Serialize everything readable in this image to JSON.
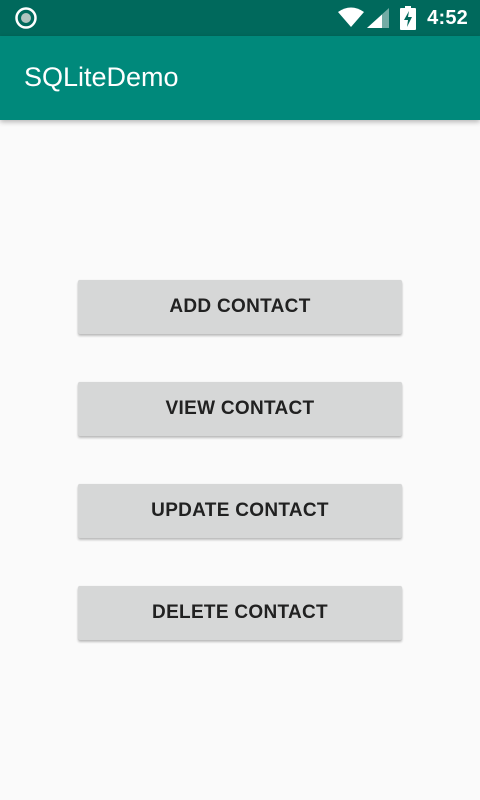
{
  "status_bar": {
    "time": "4:52",
    "icons": [
      "notification-circle-icon",
      "wifi-icon",
      "cell-signal-icon",
      "battery-charging-icon"
    ],
    "background": "#00695c"
  },
  "app_bar": {
    "title": "SQLiteDemo",
    "background": "#00897b"
  },
  "buttons": {
    "add_label": "ADD CONTACT",
    "view_label": "VIEW CONTACT",
    "update_label": "UPDATE CONTACT",
    "delete_label": "DELETE CONTACT",
    "background": "#d6d7d7"
  }
}
